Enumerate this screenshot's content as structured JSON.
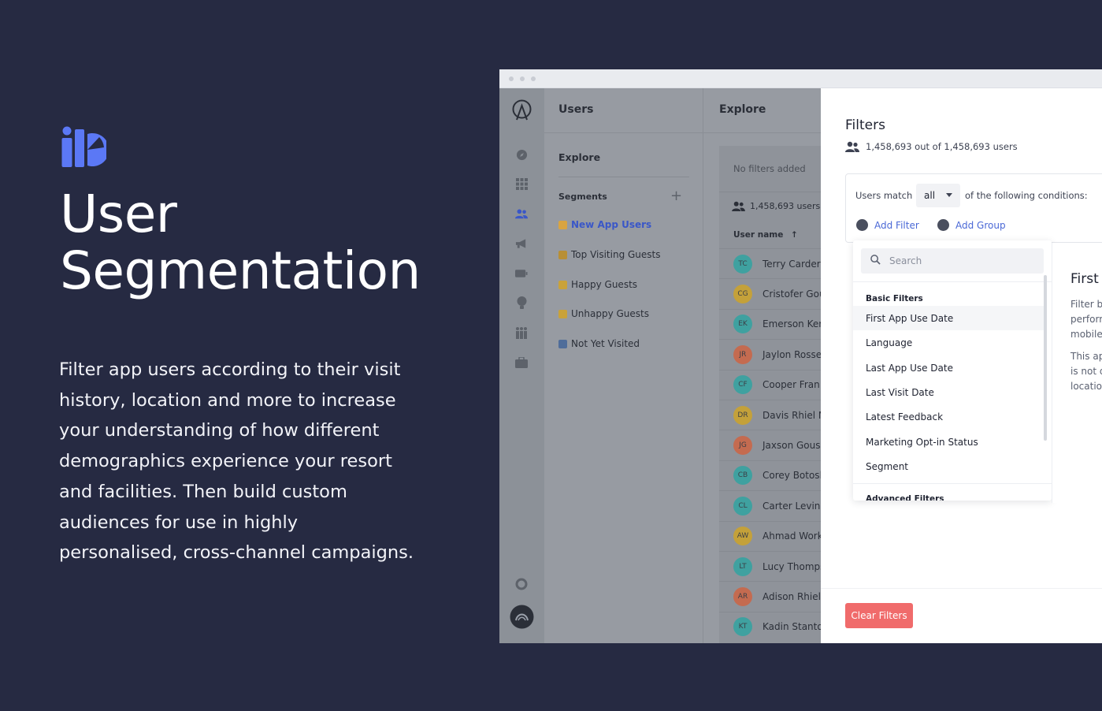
{
  "hero": {
    "title_line1": "User",
    "title_line2": "Segmentation",
    "description": "Filter app users according to their visit history, location and more to increase your understanding of how different demographics experience your resort and facilities. Then build custom audiences for use in highly personalised, cross-channel campaigns."
  },
  "colors": {
    "background": "#262a42",
    "accent": "#4a68d6",
    "danger": "#f06b6b",
    "logo": "#5b78f5"
  },
  "rail": {
    "icons": [
      "compass-icon",
      "grid-icon",
      "users-icon",
      "megaphone-icon",
      "battery-icon",
      "lightbulb-icon",
      "people-icon",
      "briefcase-icon",
      "lifebuoy-icon",
      "brand-avatar-icon"
    ],
    "active": "users-icon"
  },
  "sidebar": {
    "title": "Users",
    "explore": "Explore",
    "segments_label": "Segments",
    "segments": [
      {
        "label": "New App Users",
        "active": true,
        "emoji_color": "#d9a441"
      },
      {
        "label": "Top Visiting Guests",
        "active": false,
        "emoji_color": "#b88f35"
      },
      {
        "label": "Happy Guests",
        "active": false,
        "emoji_color": "#c9a23a"
      },
      {
        "label": "Unhappy Guests",
        "active": false,
        "emoji_color": "#c9a23a"
      },
      {
        "label": "Not Yet Visited",
        "active": false,
        "emoji_color": "#4f6d9a"
      }
    ]
  },
  "explore": {
    "title": "Explore",
    "no_filters": "No filters added",
    "user_count": "1,458,693 users",
    "column_header": "User name",
    "sort_icon": "arrow-up-icon",
    "users": [
      {
        "initials": "TC",
        "name": "Terry Carder",
        "color": "#3fa1a0"
      },
      {
        "initials": "CG",
        "name": "Cristofer Gou",
        "color": "#c4a13a"
      },
      {
        "initials": "EK",
        "name": "Emerson Ker",
        "color": "#3fa1a0"
      },
      {
        "initials": "JR",
        "name": "Jaylon Rosse",
        "color": "#c46b50"
      },
      {
        "initials": "CF",
        "name": "Cooper Fran",
        "color": "#3fa1a0"
      },
      {
        "initials": "DR",
        "name": "Davis Rhiel M",
        "color": "#c4a13a"
      },
      {
        "initials": "JG",
        "name": "Jaxson Gous",
        "color": "#c46b50"
      },
      {
        "initials": "CB",
        "name": "Corey Botosh",
        "color": "#3fa1a0"
      },
      {
        "initials": "CL",
        "name": "Carter Levin",
        "color": "#3fa1a0"
      },
      {
        "initials": "AW",
        "name": "Ahmad Work",
        "color": "#c4a13a"
      },
      {
        "initials": "LT",
        "name": "Lucy Thomps",
        "color": "#3fa1a0"
      },
      {
        "initials": "AR",
        "name": "Adison Rhiel",
        "color": "#c46b50"
      },
      {
        "initials": "KT",
        "name": "Kadin Stanto",
        "color": "#3fa1a0"
      }
    ]
  },
  "filters": {
    "title": "Filters",
    "count": "1,458,693 out of 1,458,693 users",
    "users_match": "Users match",
    "match_value": "all",
    "conditions_suffix": "of the following conditions:",
    "add_filter": "Add Filter",
    "add_group": "Add Group",
    "search_placeholder": "Search",
    "basic_group": "Basic Filters",
    "basic_items": [
      "First App Use Date",
      "Language",
      "Last App Use Date",
      "Last Visit Date",
      "Latest Feedback",
      "Marketing Opt-in Status",
      "Segment"
    ],
    "advanced_group": "Advanced Filters",
    "detail_title": "First A",
    "detail_lines": [
      "Filter b",
      "perform",
      "mobile",
      "This ap",
      "is not d",
      "locatio"
    ],
    "clear_button": "Clear Filters"
  }
}
